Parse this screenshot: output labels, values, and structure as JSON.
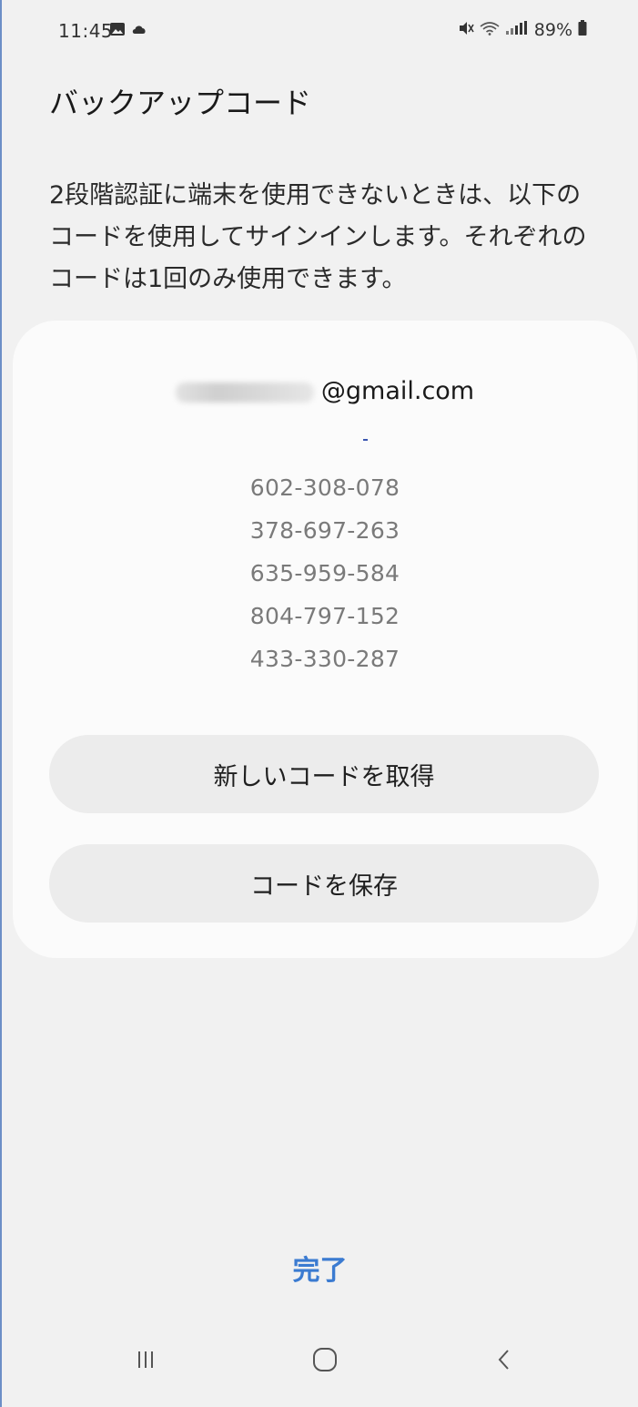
{
  "status_bar": {
    "time": "11:45",
    "battery": "89%",
    "icons": [
      "gallery-icon",
      "cloud-icon",
      "mute-icon",
      "wifi-icon",
      "signal-icon",
      "battery-icon"
    ]
  },
  "header": {
    "title": "バックアップコード"
  },
  "description": "2段階認証に端末を使用できないときは、以下のコードを使用してサインインします。それぞれのコードは1回のみ使用できます。",
  "account": {
    "email_suffix": "@gmail.com"
  },
  "codes": [
    "602-308-078",
    "378-697-263",
    "635-959-584",
    "804-797-152",
    "433-330-287"
  ],
  "buttons": {
    "get_new_codes": "新しいコードを取得",
    "save_codes": "コードを保存"
  },
  "done_label": "完了",
  "nav_bar": {
    "recent_icon": "recent-apps-icon",
    "home_icon": "home-icon",
    "back_icon": "back-icon"
  },
  "colors": {
    "background": "#f1f1f1",
    "card": "#fbfbfb",
    "button": "#ececec",
    "accent": "#3b7bd1",
    "code_text": "#7a7a7a"
  }
}
